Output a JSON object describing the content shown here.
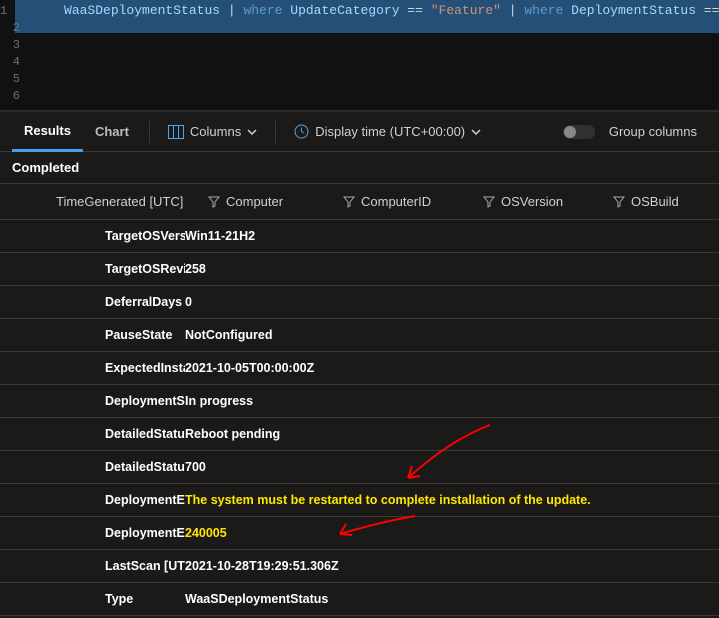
{
  "editor": {
    "lines": [
      1,
      2,
      3,
      4,
      5,
      6
    ],
    "tokens": {
      "table": "WaaSDeploymentStatus",
      "pipe": " | ",
      "where": "where",
      "sp": " ",
      "col1": "UpdateCategory",
      "eq": " == ",
      "val1": "\"Feature\"",
      "col2": "DeploymentStatus",
      "tail": " == "
    }
  },
  "toolbar": {
    "tab_results": "Results",
    "tab_chart": "Chart",
    "columns": "Columns",
    "display_time": "Display time (UTC+00:00)",
    "group_columns": "Group columns"
  },
  "group_value": "Completed",
  "columns": {
    "c1": "TimeGenerated [UTC]",
    "c2": "Computer",
    "c3": "ComputerID",
    "c4": "OSVersion",
    "c5": "OSBuild"
  },
  "rows": [
    {
      "k": "TargetOSVersion",
      "v": "Win11-21H2"
    },
    {
      "k": "TargetOSRevision",
      "v": "258"
    },
    {
      "k": "DeferralDays",
      "v": "0"
    },
    {
      "k": "PauseState",
      "v": "NotConfigured"
    },
    {
      "k": "ExpectedInstallDate [UTC]",
      "v": "2021-10-05T00:00:00Z"
    },
    {
      "k": "DeploymentStatus",
      "v": "In progress"
    },
    {
      "k": "DetailedStatus",
      "v": "Reboot pending"
    },
    {
      "k": "DetailedStatusLevel",
      "v": "700"
    },
    {
      "k": "DeploymentError",
      "v": "The system must be restarted to complete installation of the update.",
      "hl": true
    },
    {
      "k": "DeploymentErrorCode",
      "v": "240005",
      "hl": true
    },
    {
      "k": "LastScan [UTC]",
      "v": "2021-10-28T19:29:51.306Z"
    },
    {
      "k": "Type",
      "v": "WaaSDeploymentStatus"
    }
  ]
}
